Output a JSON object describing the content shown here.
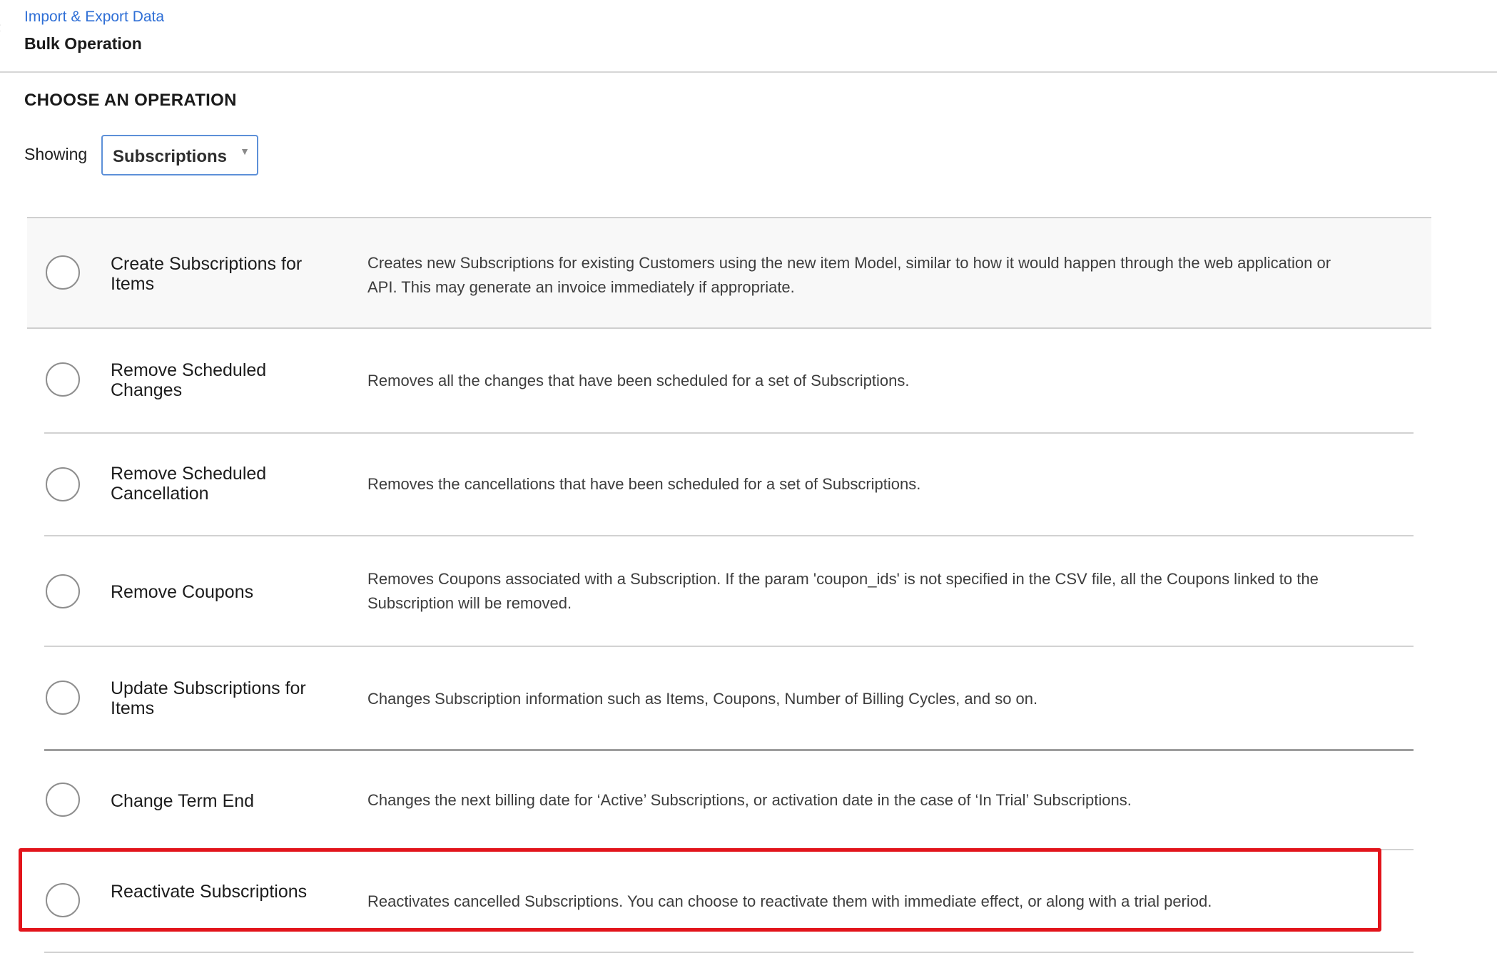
{
  "header": {
    "breadcrumb_link": "Import & Export Data",
    "title": "Bulk Operation"
  },
  "section": {
    "title": "CHOOSE AN OPERATION",
    "showing_label": "Showing",
    "select_value": "Subscriptions"
  },
  "operations": [
    {
      "name": "Create Subscriptions for Items",
      "description": "Creates new Subscriptions for existing Customers using the new item Model, similar to how it would happen through the web application or API. This may generate an invoice immediately if appropriate."
    },
    {
      "name": "Remove Scheduled Changes",
      "description": "Removes all the changes that have been scheduled for a set of Subscriptions."
    },
    {
      "name": "Remove Scheduled Cancellation",
      "description": "Removes the cancellations that have been scheduled for a set of Subscriptions."
    },
    {
      "name": "Remove Coupons",
      "description": "Removes Coupons associated with a Subscription. If the param 'coupon_ids' is not specified in the CSV file, all the Coupons linked to the Subscription will be removed."
    },
    {
      "name": "Update Subscriptions for Items",
      "description": "Changes Subscription information such as Items, Coupons, Number of Billing Cycles, and so on."
    },
    {
      "name": "Change Term End",
      "description": "Changes the next billing date for ‘Active’ Subscriptions, or activation date in the case of ‘In Trial’ Subscriptions."
    },
    {
      "name": "Reactivate Subscriptions",
      "description": "Reactivates cancelled Subscriptions. You can choose to reactivate them with immediate effect, or along with a trial period."
    }
  ],
  "highlight_color": "#e2141b",
  "link_color": "#2f6fd6"
}
